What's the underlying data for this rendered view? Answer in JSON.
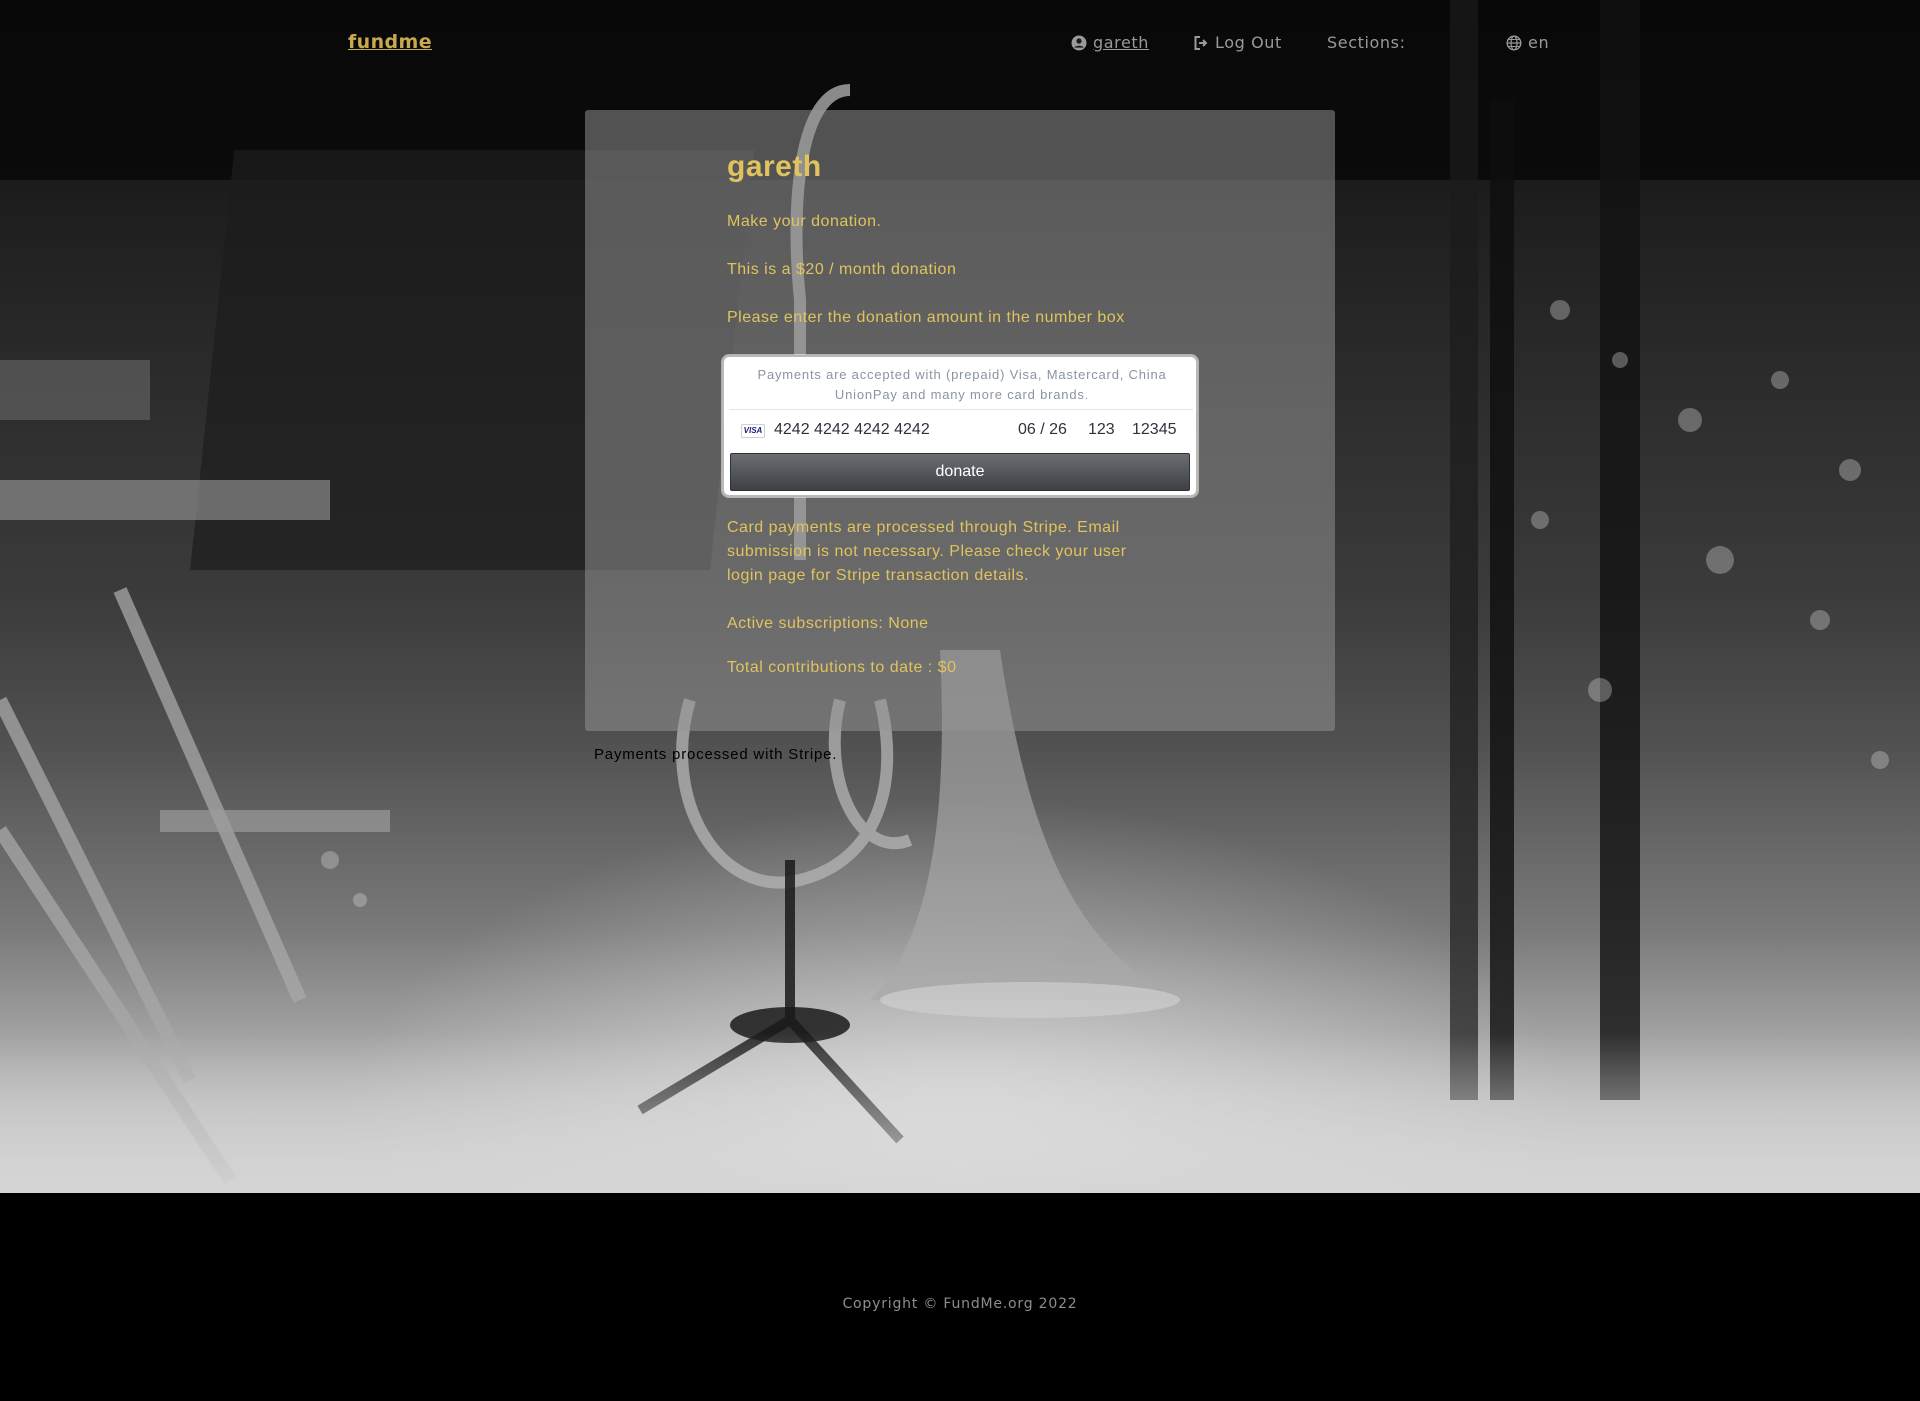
{
  "nav": {
    "brand": "fundme",
    "user_label": "gareth",
    "logout_label": "Log Out",
    "sections_label": "Sections:",
    "language_label": "en"
  },
  "main": {
    "title": "gareth",
    "make_donation": "Make your donation.",
    "monthly_note": "This is a $20 / month donation",
    "instruction": "Please enter the donation amount in the number box",
    "processing_note": "Card payments are processed through Stripe. Email submission is not necessary. Please check your user login page for Stripe transaction details.",
    "active_subscriptions": "Active subscriptions: None",
    "total_contributions": "Total contributions to date : $0"
  },
  "payment": {
    "accepted_note": "Payments are accepted with (prepaid) Visa, Mastercard, China UnionPay and many more card brands.",
    "card_brand": "VISA",
    "card_number": "4242 4242 4242 4242",
    "expiry": "06 / 26",
    "cvc": "123",
    "postal": "12345",
    "donate_label": "donate"
  },
  "stripe_note": "Payments processed with Stripe.",
  "footer": {
    "copyright": "Copyright © FundMe.org 2022"
  },
  "colors": {
    "accent_gold": "#e0c35e",
    "brand_gold": "#c9a94d",
    "footer_bg": "#000000"
  },
  "icons": {
    "user": "user-circle-icon",
    "logout": "sign-out-icon",
    "language": "globe-icon"
  }
}
